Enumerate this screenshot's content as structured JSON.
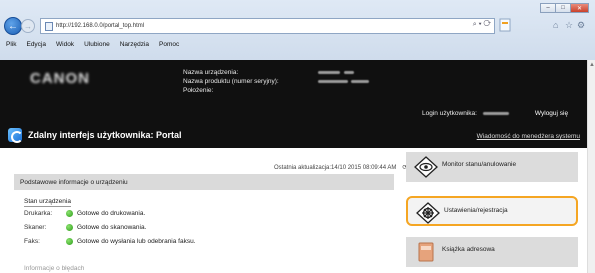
{
  "browser": {
    "url": "http://192.168.0.0/portal_top.html",
    "address_tools": "⌕ ▾ ⟳",
    "window_buttons": [
      "–",
      "□",
      "✕"
    ],
    "right_icons": [
      "⌂",
      "☆",
      "⚙"
    ],
    "menu": [
      "Plik",
      "Edycja",
      "Widok",
      "Ulubione",
      "Narzędzia",
      "Pomoc"
    ]
  },
  "header": {
    "logo": "CANON",
    "device_labels": [
      "Nazwa urządzenia:",
      "Nazwa produktu (numer seryjny):",
      "Położenie:"
    ],
    "login_label": "Login użytkownika:",
    "logout": "Wyloguj się",
    "portal_title": "Zdalny interfejs użytkownika: Portal",
    "message_link": "Wiadomość do menedżera systemu"
  },
  "content": {
    "last_update": "Ostatnia aktualizacja:14/10 2015 08:09:44 AM",
    "section_title": "Podstawowe informacje o urządzeniu",
    "status_heading": "Stan urządzenia",
    "status_rows": [
      {
        "label": "Drukarka:",
        "value": "Gotowe do drukowania."
      },
      {
        "label": "Skaner:",
        "value": "Gotowe do skanowania."
      },
      {
        "label": "Faks:",
        "value": "Gotowe do wysłania lub odebrania faksu."
      }
    ],
    "error_heading": "Informacje o błędach"
  },
  "panel": {
    "items": [
      "Monitor stanu/anulowanie",
      "Ustawienia/rejestracja",
      "Książka adresowa"
    ]
  }
}
